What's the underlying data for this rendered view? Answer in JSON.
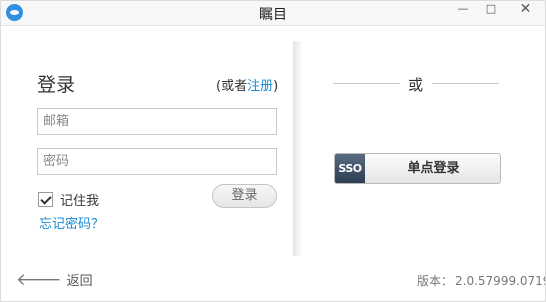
{
  "window": {
    "title": "瞩目",
    "minimize_glyph": "—",
    "maximize_glyph": "□",
    "close_glyph": "✕",
    "accent": "#1a8ad4"
  },
  "login": {
    "heading": "登录",
    "register_prefix": "(或者",
    "register_link": "注册",
    "register_suffix": ")",
    "email_placeholder": "邮箱",
    "password_placeholder": "密码",
    "remember_label": "记住我",
    "remember_checked": true,
    "login_button": "登录",
    "forgot_link": "忘记密码？"
  },
  "alt": {
    "or_text": "或",
    "sso_badge": "SSO",
    "sso_button": "单点登录"
  },
  "footer": {
    "back_icon": "back-arrow-icon",
    "back_label": "返回",
    "version_label": "版本：",
    "version_number": "2.0.57999.0719"
  }
}
